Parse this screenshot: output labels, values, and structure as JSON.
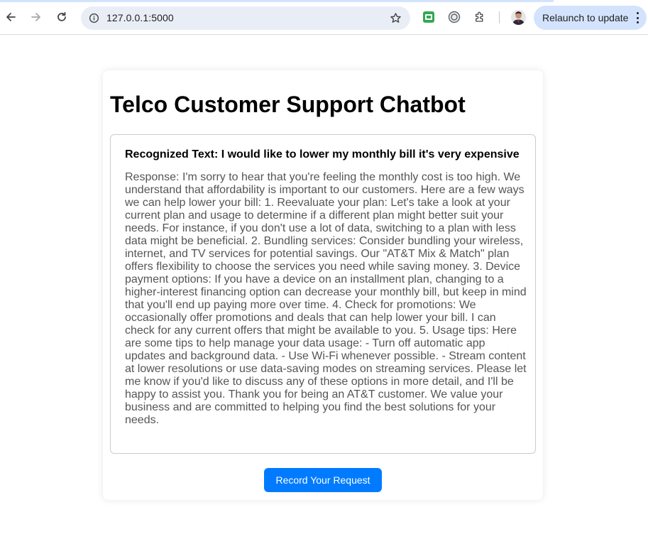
{
  "browser": {
    "url": "127.0.0.1:5000",
    "relaunch_label": "Relaunch to update",
    "icons": [
      "back-arrow-icon",
      "forward-arrow-icon",
      "reload-icon",
      "site-info-icon",
      "bookmark-star-icon",
      "extension-green-icon",
      "extension-circle-icon",
      "extensions-puzzle-icon",
      "profile-avatar",
      "menu-dots-icon"
    ],
    "accent_color": "#d3e3fd"
  },
  "page": {
    "title": "Telco Customer Support Chatbot",
    "recognized_text": "Recognized Text: I would like to lower my monthly bill it's very expensive",
    "response": "Response: I'm sorry to hear that you're feeling the monthly cost is too high. We understand that affordability is important to our customers. Here are a few ways we can help lower your bill: 1. Reevaluate your plan: Let's take a look at your current plan and usage to determine if a different plan might better suit your needs. For instance, if you don't use a lot of data, switching to a plan with less data might be beneficial. 2. Bundling services: Consider bundling your wireless, internet, and TV services for potential savings. Our \"AT&T Mix & Match\" plan offers flexibility to choose the services you need while saving money. 3. Device payment options: If you have a device on an installment plan, changing to a higher-interest financing option can decrease your monthly bill, but keep in mind that you'll end up paying more over time. 4. Check for promotions: We occasionally offer promotions and deals that can help lower your bill. I can check for any current offers that might be available to you. 5. Usage tips: Here are some tips to help manage your data usage: - Turn off automatic app updates and background data. - Use Wi-Fi whenever possible. - Stream content at lower resolutions or use data-saving modes on streaming services. Please let me know if you'd like to discuss any of these options in more detail, and I'll be happy to assist you. Thank you for being an AT&T customer. We value your business and are committed to helping you find the best solutions for your needs.",
    "record_button_label": "Record Your Request",
    "button_color": "#007bff"
  }
}
